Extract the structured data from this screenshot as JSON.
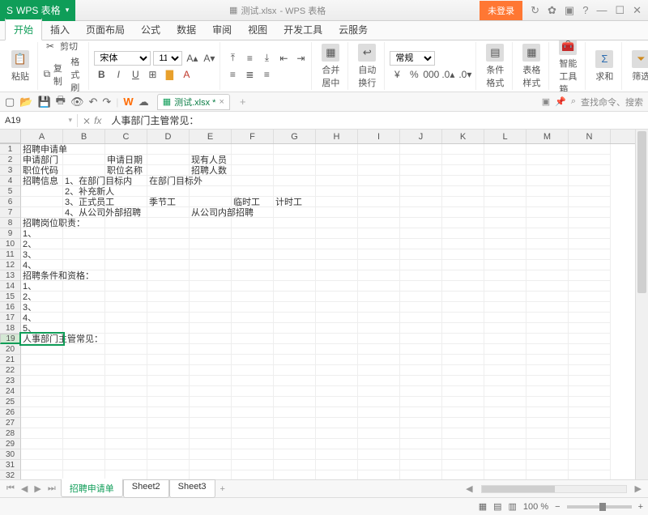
{
  "title": {
    "app": "WPS 表格",
    "doc_hint": "测试.xlsx",
    "suffix": " - WPS 表格"
  },
  "login": {
    "label": "未登录"
  },
  "menus": [
    "开始",
    "插入",
    "页面布局",
    "公式",
    "数据",
    "审阅",
    "视图",
    "开发工具",
    "云服务"
  ],
  "active_menu": 0,
  "ribbon": {
    "paste": "粘贴",
    "cut": "剪切",
    "copy": "复制",
    "fmtpaint": "格式刷",
    "font": "宋体",
    "size": "11",
    "general": "常规",
    "merge": "合并居中",
    "wrap": "自动换行",
    "condfmt": "条件格式",
    "tblstyle": "表格样式",
    "smarttool": "智能工具箱",
    "sum": "求和",
    "filter": "筛选"
  },
  "doctab": {
    "name": "测试.xlsx *"
  },
  "quick_search": {
    "cmd": "查找命令、搜索",
    "hint": "⌕"
  },
  "namebox": "A19",
  "fx_value": "人事部门主管常见：",
  "cols": [
    "A",
    "B",
    "C",
    "D",
    "E",
    "F",
    "G",
    "H",
    "I",
    "J",
    "K",
    "L",
    "M",
    "N"
  ],
  "rows": 35,
  "active_row": 19,
  "cells": {
    "1": {
      "A": "招聘申请单"
    },
    "2": {
      "A": "申请部门",
      "C": "申请日期",
      "E": "现有人员"
    },
    "3": {
      "A": "职位代码",
      "C": "职位名称",
      "E": "招聘人数"
    },
    "4": {
      "A": "招聘信息",
      "B": "1、在部门目标内",
      "D": "在部门目标外"
    },
    "5": {
      "B": "2、补充新人"
    },
    "6": {
      "B": "3、正式员工",
      "D": "季节工",
      "F": "临时工",
      "G": "计时工"
    },
    "7": {
      "B": "4、从公司外部招聘",
      "E": "从公司内部招聘"
    },
    "8": {
      "A": "招聘岗位职责："
    },
    "9": {
      "A": "1、"
    },
    "10": {
      "A": "2、"
    },
    "11": {
      "A": "3、"
    },
    "12": {
      "A": "4、"
    },
    "13": {
      "A": "招聘条件和资格："
    },
    "14": {
      "A": "1、"
    },
    "15": {
      "A": "2、"
    },
    "16": {
      "A": "3、"
    },
    "17": {
      "A": "4、"
    },
    "18": {
      "A": "5、"
    },
    "19": {
      "A": "人事部门主管常见："
    }
  },
  "sheets": [
    "招聘申请单",
    "Sheet2",
    "Sheet3"
  ],
  "active_sheet": 0,
  "zoom": "100 %"
}
